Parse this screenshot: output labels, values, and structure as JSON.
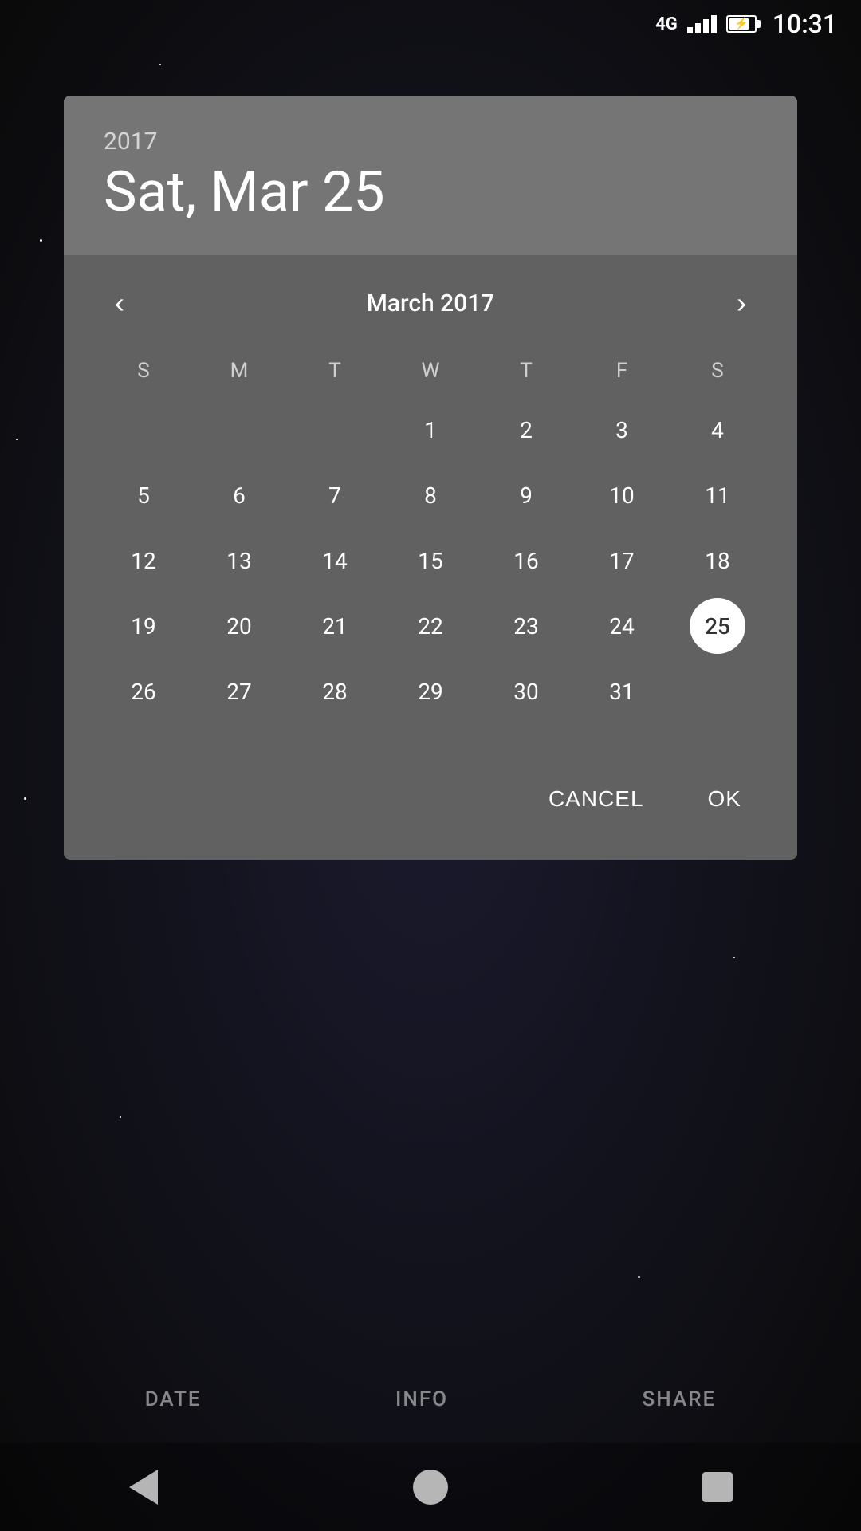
{
  "statusBar": {
    "signal": "4G",
    "time": "10:31"
  },
  "dialog": {
    "header": {
      "year": "2017",
      "dateLabel": "Sat, Mar 25"
    },
    "calendar": {
      "monthYear": "March 2017",
      "dayHeaders": [
        "S",
        "M",
        "T",
        "W",
        "T",
        "F",
        "S"
      ],
      "prevArrow": "‹",
      "nextArrow": "›",
      "weeks": [
        [
          "",
          "",
          "",
          "1",
          "2",
          "3",
          "4"
        ],
        [
          "5",
          "6",
          "7",
          "8",
          "9",
          "10",
          "11"
        ],
        [
          "12",
          "13",
          "14",
          "15",
          "16",
          "17",
          "18"
        ],
        [
          "19",
          "20",
          "21",
          "22",
          "23",
          "24",
          "25"
        ],
        [
          "26",
          "27",
          "28",
          "29",
          "30",
          "31",
          ""
        ]
      ],
      "selectedDay": "25"
    },
    "actions": {
      "cancel": "CANCEL",
      "ok": "OK"
    }
  },
  "bottomNav": {
    "items": [
      "DATE",
      "INFO",
      "SHARE"
    ]
  },
  "sysNav": {
    "back": "back",
    "home": "home",
    "recents": "recents"
  }
}
